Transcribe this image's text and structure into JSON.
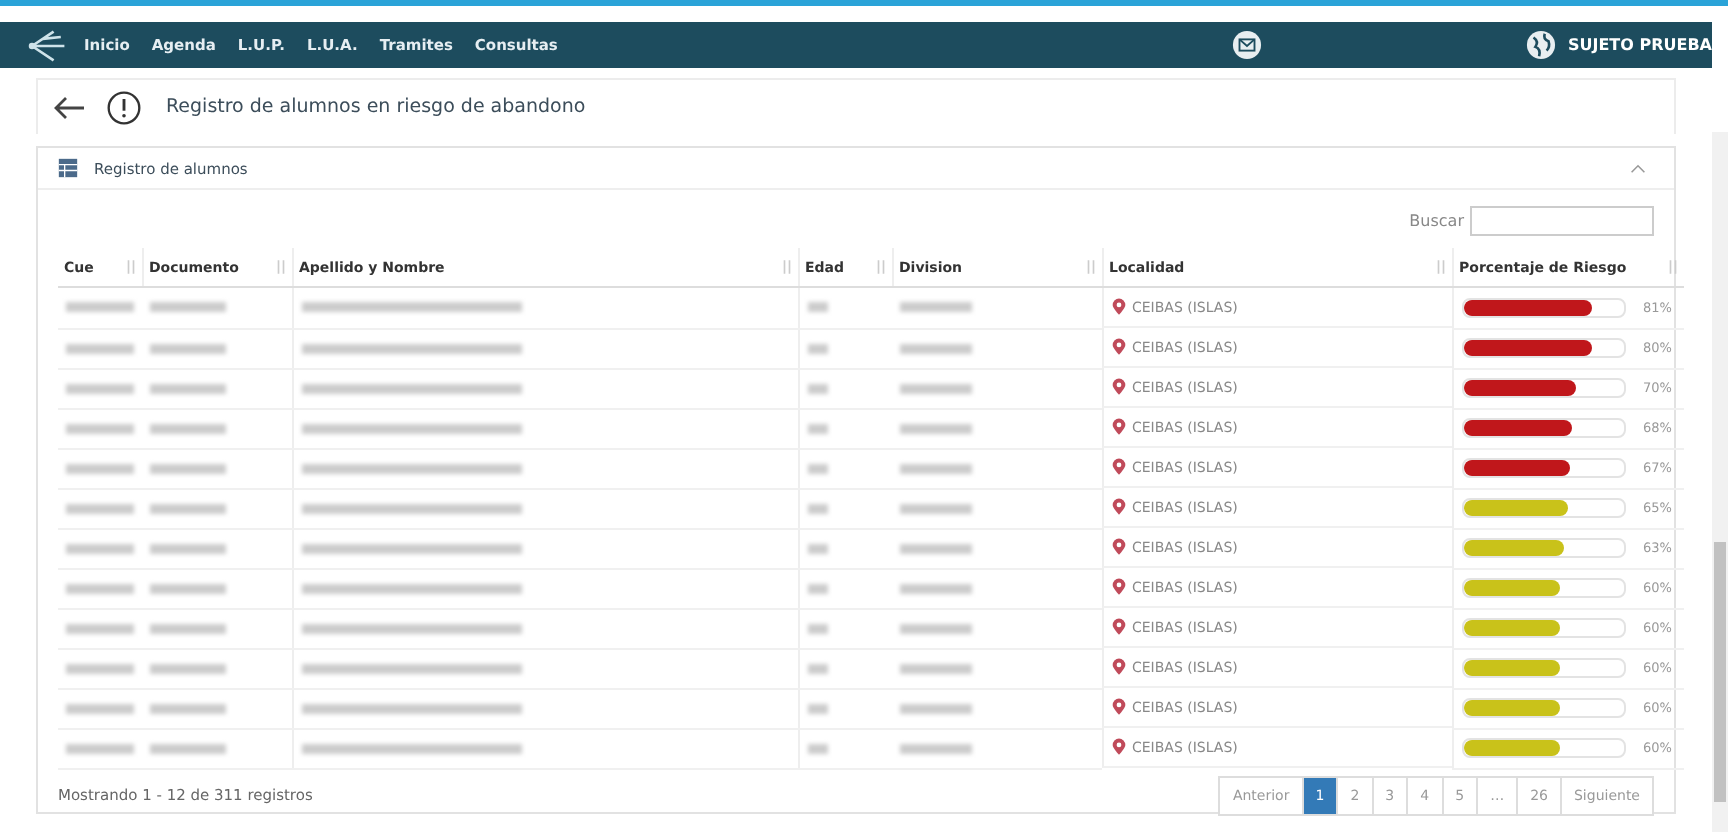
{
  "nav": {
    "items": [
      "Inicio",
      "Agenda",
      "L.U.P.",
      "L.U.A.",
      "Tramites",
      "Consultas"
    ],
    "user": "SUJETO PRUEBA"
  },
  "page": {
    "title": "Registro de alumnos en riesgo de abandono"
  },
  "card": {
    "title": "Registro de alumnos",
    "expanded": true
  },
  "search": {
    "label": "Buscar"
  },
  "table": {
    "columns": [
      "Cue",
      "Documento",
      "Apellido y Nombre",
      "Edad",
      "Division",
      "Localidad",
      "Porcentaje de Riesgo"
    ],
    "rows": [
      {
        "localidad": "CEIBAS (ISLAS)",
        "level": 0.81,
        "reading": "81%",
        "color": "#c0171b"
      },
      {
        "localidad": "CEIBAS (ISLAS)",
        "level": 0.8,
        "reading": "80%",
        "color": "#c0171b"
      },
      {
        "localidad": "CEIBAS (ISLAS)",
        "level": 0.7,
        "reading": "70%",
        "color": "#c0171b"
      },
      {
        "localidad": "CEIBAS (ISLAS)",
        "level": 0.68,
        "reading": "68%",
        "color": "#c0171b"
      },
      {
        "localidad": "CEIBAS (ISLAS)",
        "level": 0.67,
        "reading": "67%",
        "color": "#c0171b"
      },
      {
        "localidad": "CEIBAS (ISLAS)",
        "level": 0.65,
        "reading": "65%",
        "color": "#c9c21a"
      },
      {
        "localidad": "CEIBAS (ISLAS)",
        "level": 0.63,
        "reading": "63%",
        "color": "#c9c21a"
      },
      {
        "localidad": "CEIBAS (ISLAS)",
        "level": 0.6,
        "reading": "60%",
        "color": "#c9c21a"
      },
      {
        "localidad": "CEIBAS (ISLAS)",
        "level": 0.6,
        "reading": "60%",
        "color": "#c9c21a"
      },
      {
        "localidad": "CEIBAS (ISLAS)",
        "level": 0.6,
        "reading": "60%",
        "color": "#c9c21a"
      },
      {
        "localidad": "CEIBAS (ISLAS)",
        "level": 0.6,
        "reading": "60%",
        "color": "#c9c21a"
      },
      {
        "localidad": "CEIBAS (ISLAS)",
        "level": 0.6,
        "reading": "60%",
        "color": "#c9c21a"
      }
    ]
  },
  "footer": {
    "info": "Mostrando 1 - 12 de 311 registros"
  },
  "pagination": [
    {
      "label": "Anterior",
      "selected": false
    },
    {
      "label": "1",
      "selected": true
    },
    {
      "label": "2",
      "selected": false
    },
    {
      "label": "3",
      "selected": false
    },
    {
      "label": "4",
      "selected": false
    },
    {
      "label": "5",
      "selected": false
    },
    {
      "label": "…",
      "selected": false
    },
    {
      "label": "26",
      "selected": false
    },
    {
      "label": "Siguiente",
      "selected": false
    }
  ]
}
